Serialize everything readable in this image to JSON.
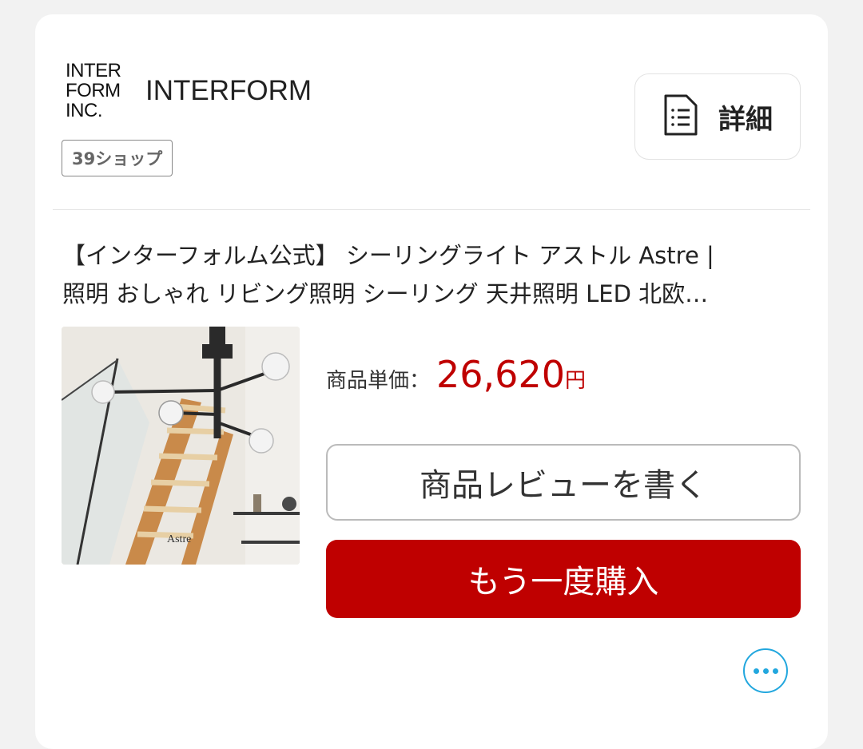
{
  "shop": {
    "logo_lines": [
      "INTER",
      "FORM",
      "INC."
    ],
    "name": "INTERFORM",
    "badge": "39ショップ",
    "detail_label": "詳細"
  },
  "product": {
    "title_line1": "【インターフォルム公式】 シーリングライト アストル Astre |",
    "title_line2": "照明 おしゃれ リビング照明 シーリング 天井照明 LED 北欧…",
    "image_text": "Astre",
    "price_label": "商品単価：",
    "price_value": "26,620",
    "price_unit": "円"
  },
  "actions": {
    "review_label": "商品レビューを書く",
    "rebuy_label": "もう一度購入",
    "more_icon": "ellipsis-icon"
  },
  "colors": {
    "accent_red": "#bf0000",
    "more_blue": "#22a7de",
    "background": "#f2f2f2",
    "card": "#ffffff"
  }
}
